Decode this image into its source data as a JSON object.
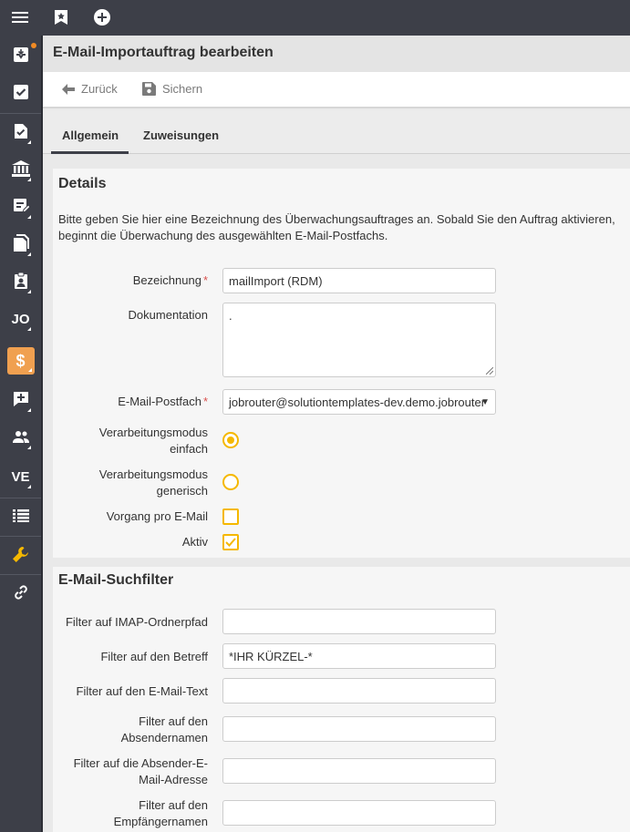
{
  "topbar": {
    "icons": [
      "menu-icon",
      "bookmark-star-icon",
      "add-circle-icon"
    ]
  },
  "sidebar": {
    "items": [
      {
        "name": "inbox-icon",
        "has_badge": true
      },
      {
        "name": "task-check-icon"
      },
      {
        "name": "document-check-icon"
      },
      {
        "name": "bank-icon"
      },
      {
        "name": "form-edit-icon"
      },
      {
        "name": "documents-icon"
      },
      {
        "name": "clipboard-user-icon"
      },
      {
        "label": "JO"
      },
      {
        "label": "$",
        "active": true
      },
      {
        "name": "chat-add-icon"
      },
      {
        "name": "users-icon"
      },
      {
        "label": "VE"
      },
      {
        "name": "list-icon"
      },
      {
        "name": "wrench-icon"
      },
      {
        "name": "link-icon"
      }
    ],
    "accent_color": "#f0a050"
  },
  "page": {
    "title": "E-Mail-Importauftrag bearbeiten"
  },
  "toolbar": {
    "back_label": "Zurück",
    "save_label": "Sichern"
  },
  "tabs": [
    {
      "label": "Allgemein",
      "active": true
    },
    {
      "label": "Zuweisungen",
      "active": false
    }
  ],
  "details": {
    "heading": "Details",
    "description": "Bitte geben Sie hier eine Bezeichnung des Überwachungsauftrages an. Sobald Sie den Auftrag aktivieren, beginnt die Überwachung des ausgewählten E-Mail-Postfachs.",
    "bezeichnung_label": "Bezeichnung",
    "bezeichnung_value": "mailImport (RDM)",
    "dokumentation_label": "Dokumentation",
    "dokumentation_value": ".",
    "postfach_label": "E-Mail-Postfach",
    "postfach_value": "jobrouter@solutiontemplates-dev.demo.jobrouter",
    "modus_einfach_label": "Verarbeitungsmodus einfach",
    "modus_einfach_selected": true,
    "modus_generisch_label": "Verarbeitungsmodus generisch",
    "modus_generisch_selected": false,
    "vorgang_label": "Vorgang pro E-Mail",
    "vorgang_checked": false,
    "aktiv_label": "Aktiv",
    "aktiv_checked": true,
    "required_marker": "*"
  },
  "filter": {
    "heading": "E-Mail-Suchfilter",
    "imap_label": "Filter auf IMAP-Ordnerpfad",
    "imap_value": "",
    "betreff_label": "Filter auf den Betreff",
    "betreff_value": "*IHR KÜRZEL-*",
    "text_label": "Filter auf den E-Mail-Text",
    "text_value": "",
    "absendername_label": "Filter auf den Absendernamen",
    "absendername_value": "",
    "absenderadresse_label": "Filter auf die Absender-E-Mail-Adresse",
    "absenderadresse_value": "",
    "empfaenger_label": "Filter auf den Empfängernamen",
    "empfaenger_value": ""
  },
  "colors": {
    "sidebar_bg": "#3d3f48",
    "control_accent": "#f5b800",
    "required": "#d9534f"
  }
}
